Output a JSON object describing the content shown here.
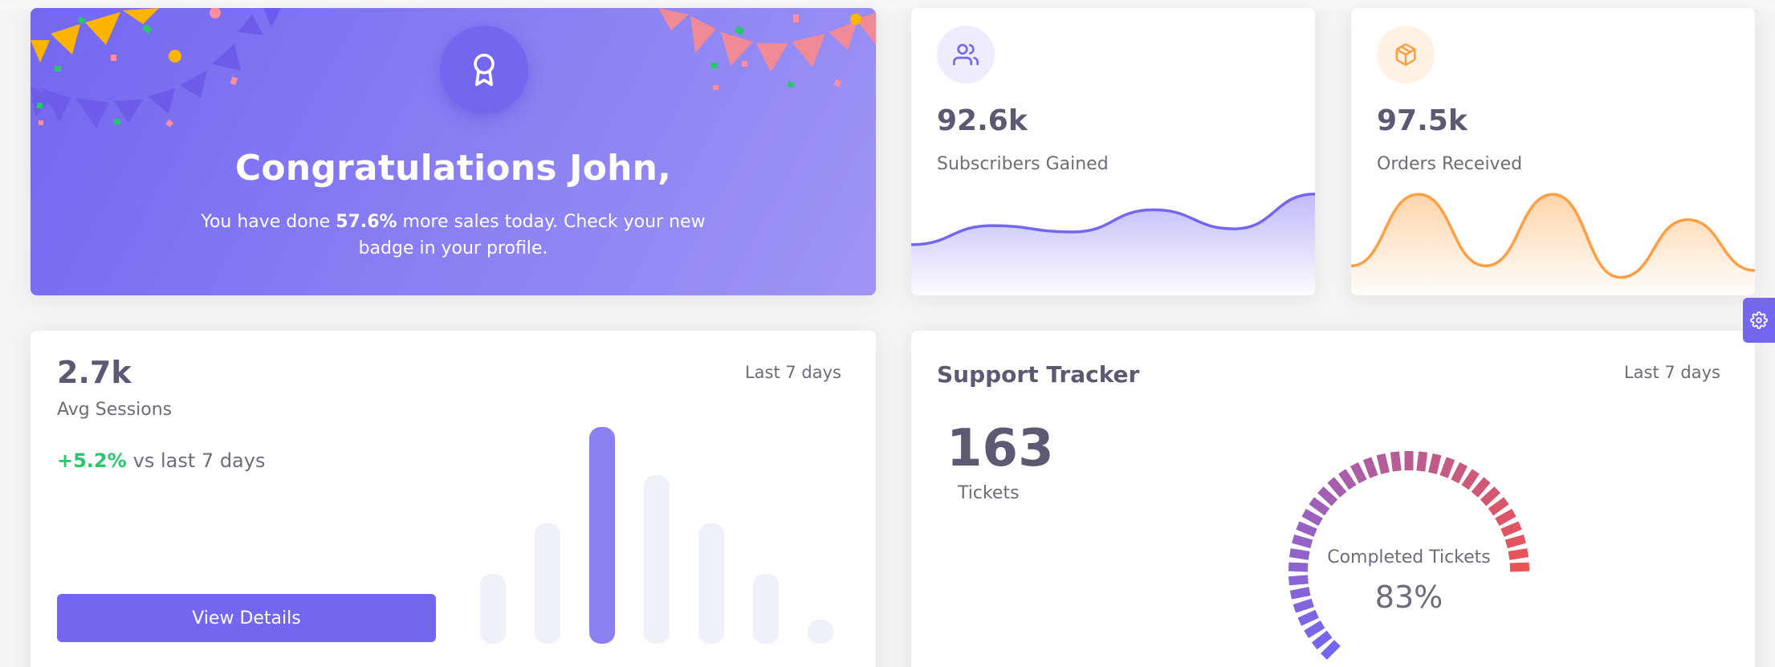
{
  "congrats": {
    "title": "Congratulations John,",
    "text_before": "You have done ",
    "text_highlight": "57.6%",
    "text_after": " more sales today. Check your new badge in your profile.",
    "icon": "award-icon"
  },
  "subscribers": {
    "value": "92.6k",
    "label": "Subscribers Gained",
    "icon": "users-icon",
    "color": "#7367f0"
  },
  "orders": {
    "value": "97.5k",
    "label": "Orders Received",
    "icon": "package-icon",
    "color": "#ff9f43"
  },
  "sessions": {
    "value": "2.7k",
    "label": "Avg Sessions",
    "change_pct": "+5.2%",
    "change_text": "vs last 7 days",
    "range": "Last 7 days",
    "button_label": "View Details"
  },
  "tracker": {
    "title": "Support Tracker",
    "range": "Last 7 days",
    "total": "163",
    "total_label": "Tickets",
    "gauge_label": "Completed Tickets",
    "gauge_value": "83%"
  },
  "chart_data": [
    {
      "type": "area",
      "x": [
        0,
        1,
        2,
        3,
        4,
        5
      ],
      "values": [
        28,
        40,
        36,
        50,
        38,
        60
      ],
      "color": "#7367f0"
    },
    {
      "type": "area",
      "x": [
        0,
        1,
        2,
        3,
        4,
        5,
        6
      ],
      "values": [
        10,
        41,
        10,
        41,
        5,
        30,
        8
      ],
      "color": "#ff9f43"
    },
    {
      "type": "bar",
      "categories": [
        "1",
        "2",
        "3",
        "4",
        "5",
        "6",
        "7"
      ],
      "values": [
        29,
        50,
        90,
        70,
        50,
        29,
        10
      ],
      "highlight_index": 2,
      "highlight_color": "#8b80f2",
      "bar_color": "#eef1f7"
    },
    {
      "type": "pie",
      "values": [
        83
      ],
      "colors": [
        "#7367f0",
        "#ea5455"
      ]
    }
  ]
}
